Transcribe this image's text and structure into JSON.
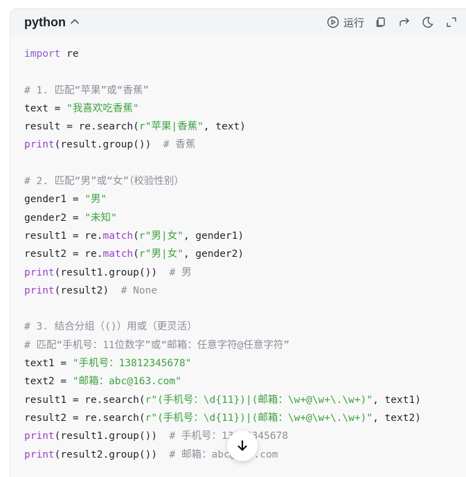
{
  "header": {
    "language": "python",
    "run_label": "运行"
  },
  "icons": {
    "collapse": "chevron-up-icon",
    "run": "play-circle-icon",
    "copy": "copy-icon",
    "share": "share-arrow-icon",
    "theme": "moon-icon",
    "expand": "expand-icon",
    "scroll": "arrow-down-icon"
  },
  "colors": {
    "keyword": "#8c5cc6",
    "function": "#9b40c9",
    "string": "#3ba23b",
    "comment": "#8a8f98"
  },
  "code_lines": [
    [
      {
        "t": "import",
        "c": "kw"
      },
      {
        "t": " re",
        "c": "plain"
      }
    ],
    [],
    [
      {
        "t": "# 1. 匹配“苹果”或“香蕉”",
        "c": "cmt"
      }
    ],
    [
      {
        "t": "text = ",
        "c": "plain"
      },
      {
        "t": "\"我喜欢吃香蕉\"",
        "c": "str"
      }
    ],
    [
      {
        "t": "result = re.search(",
        "c": "plain"
      },
      {
        "t": "r\"苹果|香蕉\"",
        "c": "str"
      },
      {
        "t": ", text)",
        "c": "plain"
      }
    ],
    [
      {
        "t": "print",
        "c": "fn"
      },
      {
        "t": "(result.group())  ",
        "c": "plain"
      },
      {
        "t": "# 香蕉",
        "c": "cmt"
      }
    ],
    [],
    [
      {
        "t": "# 2. 匹配“男”或“女”（校验性别）",
        "c": "cmt"
      }
    ],
    [
      {
        "t": "gender1 = ",
        "c": "plain"
      },
      {
        "t": "\"男\"",
        "c": "str"
      }
    ],
    [
      {
        "t": "gender2 = ",
        "c": "plain"
      },
      {
        "t": "\"未知\"",
        "c": "str"
      }
    ],
    [
      {
        "t": "result1 = re.",
        "c": "plain"
      },
      {
        "t": "match",
        "c": "fn"
      },
      {
        "t": "(",
        "c": "plain"
      },
      {
        "t": "r\"男|女\"",
        "c": "str"
      },
      {
        "t": ", gender1)",
        "c": "plain"
      }
    ],
    [
      {
        "t": "result2 = re.",
        "c": "plain"
      },
      {
        "t": "match",
        "c": "fn"
      },
      {
        "t": "(",
        "c": "plain"
      },
      {
        "t": "r\"男|女\"",
        "c": "str"
      },
      {
        "t": ", gender2)",
        "c": "plain"
      }
    ],
    [
      {
        "t": "print",
        "c": "fn"
      },
      {
        "t": "(result1.group())  ",
        "c": "plain"
      },
      {
        "t": "# 男",
        "c": "cmt"
      }
    ],
    [
      {
        "t": "print",
        "c": "fn"
      },
      {
        "t": "(result2)  ",
        "c": "plain"
      },
      {
        "t": "# None",
        "c": "cmt"
      }
    ],
    [],
    [
      {
        "t": "# 3. 结合分组（()）用或（更灵活）",
        "c": "cmt"
      }
    ],
    [
      {
        "t": "# 匹配“手机号：11位数字”或“邮箱：任意字符@任意字符”",
        "c": "cmt"
      }
    ],
    [
      {
        "t": "text1 = ",
        "c": "plain"
      },
      {
        "t": "\"手机号：13812345678\"",
        "c": "str"
      }
    ],
    [
      {
        "t": "text2 = ",
        "c": "plain"
      },
      {
        "t": "\"邮箱：abc@163.com\"",
        "c": "str"
      }
    ],
    [
      {
        "t": "result1 = re.search(",
        "c": "plain"
      },
      {
        "t": "r\"(手机号：\\d{11})|(邮箱：\\w+@\\w+\\.\\w+)\"",
        "c": "str"
      },
      {
        "t": ", text1)",
        "c": "plain"
      }
    ],
    [
      {
        "t": "result2 = re.search(",
        "c": "plain"
      },
      {
        "t": "r\"(手机号：\\d{11})|(邮箱：\\w+@\\w+\\.\\w+)\"",
        "c": "str"
      },
      {
        "t": ", text2)",
        "c": "plain"
      }
    ],
    [
      {
        "t": "print",
        "c": "fn"
      },
      {
        "t": "(result1.group())  ",
        "c": "plain"
      },
      {
        "t": "# 手机号：13812345678",
        "c": "cmt"
      }
    ],
    [
      {
        "t": "print",
        "c": "fn"
      },
      {
        "t": "(result2.group())  ",
        "c": "plain"
      },
      {
        "t": "# 邮箱：abc@163.com",
        "c": "cmt"
      }
    ]
  ]
}
